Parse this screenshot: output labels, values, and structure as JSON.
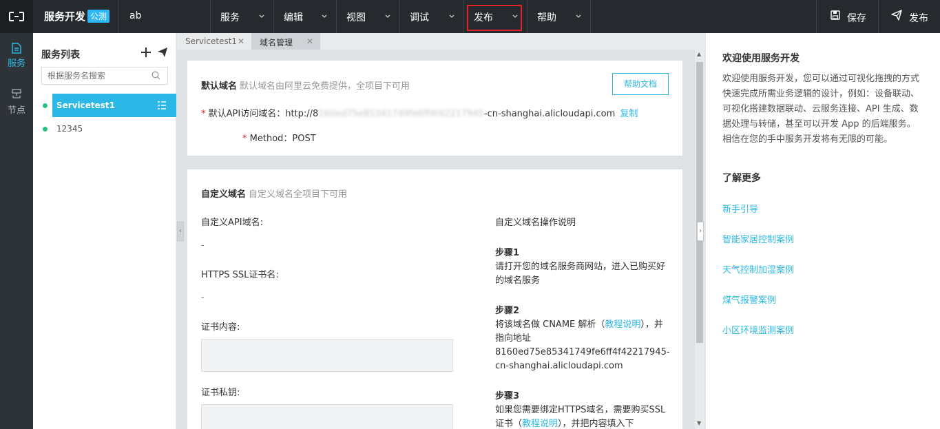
{
  "topbar": {
    "app_title": "服务开发",
    "beta_badge": "公测",
    "project_name": "ab",
    "menus": [
      {
        "label": "服务"
      },
      {
        "label": "编辑"
      },
      {
        "label": "视图"
      },
      {
        "label": "调试"
      },
      {
        "label": "发布"
      },
      {
        "label": "帮助"
      }
    ],
    "save_label": "保存",
    "publish_label": "发布",
    "highlight_color": "#e3212c"
  },
  "rail": {
    "items": [
      {
        "label": "服务",
        "icon": "document-icon",
        "active": true
      },
      {
        "label": "节点",
        "icon": "node-icon",
        "active": false
      }
    ]
  },
  "service_list": {
    "title": "服务列表",
    "search_placeholder": "根据服务名搜索",
    "items": [
      {
        "name": "Servicetest1",
        "active": true
      },
      {
        "name": "12345",
        "active": false
      }
    ]
  },
  "tabs": [
    {
      "label": "Servicetest1",
      "active": false
    },
    {
      "label": "域名管理",
      "active": true
    }
  ],
  "default_domain": {
    "title": "默认域名",
    "subtitle": "默认域名由阿里云免费提供，全项目下可用",
    "help_button": "帮助文档",
    "api_label": "默认API访问域名：",
    "api_prefix": "http://8",
    "api_hidden": "160ed75e85341749fe6ff4f42217945",
    "api_suffix": "-cn-shanghai.alicloudapi.com",
    "copy_label": "复制",
    "method_label": "Method：",
    "method_value": "POST"
  },
  "custom_domain": {
    "title": "自定义域名",
    "subtitle": "自定义域名全项目下可用",
    "api_domain_label": "自定义API域名:",
    "api_domain_value": "-",
    "ssl_label": "HTTPS SSL证书名:",
    "ssl_value": "-",
    "cert_content_label": "证书内容:",
    "cert_key_label": "证书私钥:",
    "guide_title": "自定义域名操作说明",
    "step1_title": "步骤1",
    "step1_text": "请打开您的域名服务商网站，进入已购买好的域名服务",
    "step2_title": "步骤2",
    "step2_text_a": "将该域名做 CNAME 解析（",
    "step2_link": "教程说明",
    "step2_text_b": "），并指向地址",
    "step2_address": "8160ed75e85341749fe6ff4f42217945-cn-shanghai.alicloudapi.com",
    "step3_title": "步骤3",
    "step3_text_a": "如果您需要绑定HTTPS域名，需要购买SSL证书（",
    "step3_link": "教程说明",
    "step3_text_b": "），并把内容填入下"
  },
  "info_panel": {
    "title": "欢迎使用服务开发",
    "description": "欢迎使用服务开发，您可以通过可视化拖拽的方式快速完成所需业务逻辑的设计，例如：设备联动、可视化搭建数据联动、云服务连接、API 生成、数据处理与转储，甚至可以开发 App 的后端服务。相信在您的手中服务开发将有无限的可能。",
    "more_title": "了解更多",
    "links": [
      "新手引导",
      "智能家居控制案例",
      "天气控制加湿案例",
      "煤气报警案例",
      "小区环境监测案例"
    ]
  }
}
